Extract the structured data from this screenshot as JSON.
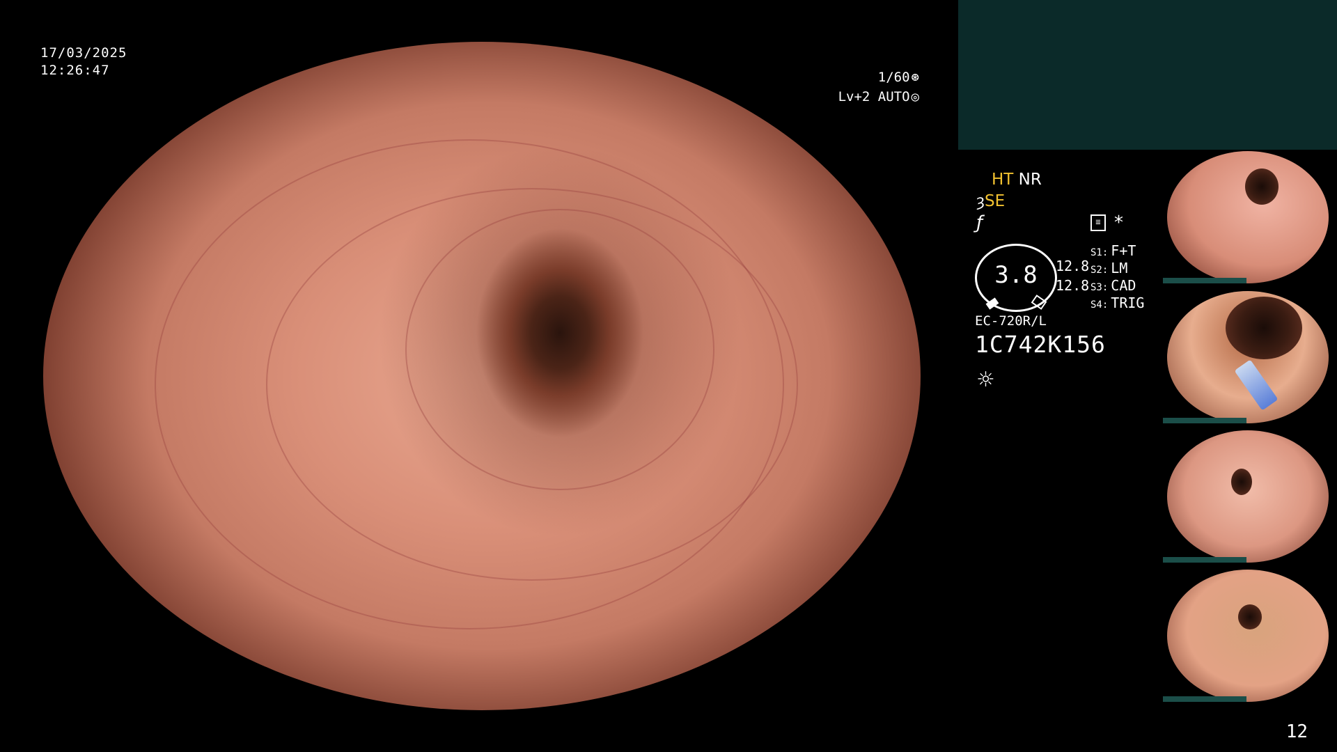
{
  "overlay": {
    "date": "17/03/2025",
    "time": "12:26:47",
    "shutter": "1/60",
    "shutter_icon": "⊛",
    "level": "Lv+2 AUTO",
    "level_icon": "◎"
  },
  "settings": {
    "ht": "HT",
    "nr": "NR",
    "se_icon": "ȝ",
    "se": "SE",
    "f_icon": "ƒ",
    "gauge_value": "3.8",
    "val1": "12.8",
    "val2": "12.8",
    "memo_icon": "≣",
    "star_icon": "*",
    "s_rows": [
      {
        "key": "S1:",
        "value": "F+T"
      },
      {
        "key": "S2:",
        "value": "LM"
      },
      {
        "key": "S3:",
        "value": "CAD"
      },
      {
        "key": "S4:",
        "value": "TRIG"
      }
    ],
    "scope_model": "EC-720R/L",
    "scope_serial": "1C742K156",
    "light_icon": "☼"
  },
  "page_number": "12"
}
